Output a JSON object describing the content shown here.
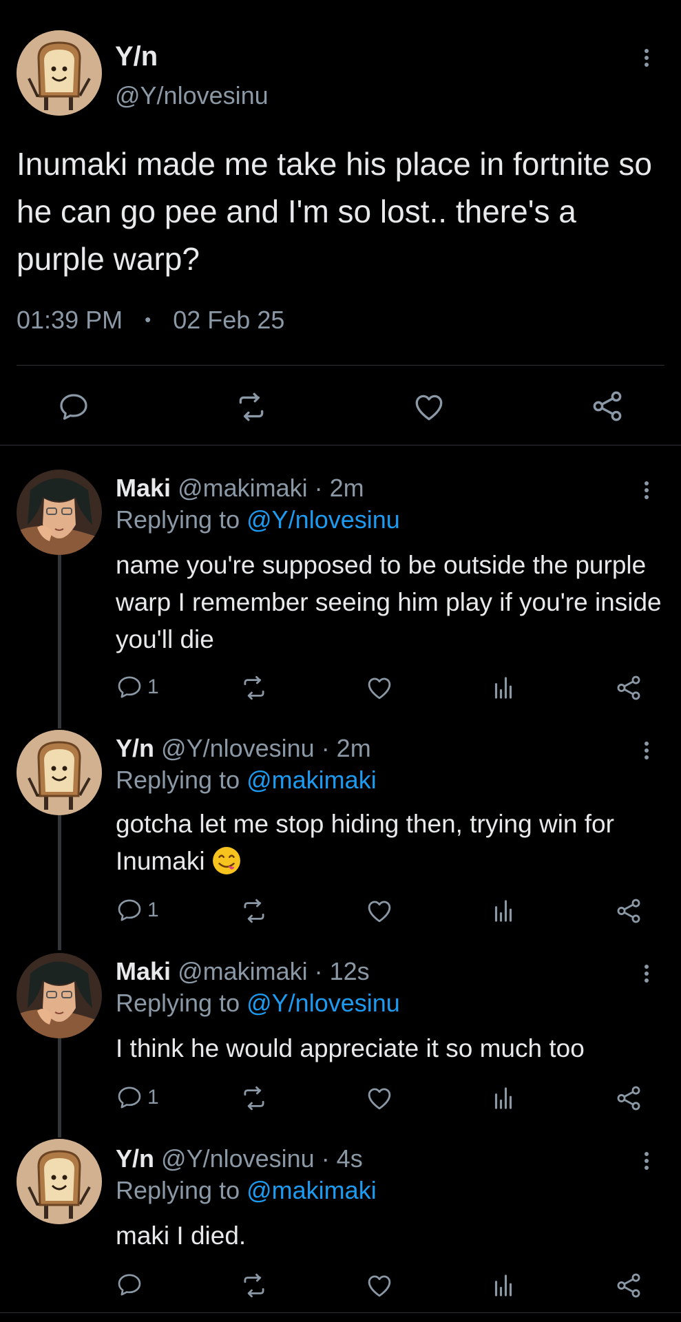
{
  "main_tweet": {
    "display_name": "Y/n",
    "handle": "@Y/nlovesinu",
    "text": "Inumaki made me take his place in fortnite so he can go pee and I'm so lost.. there's a purple warp?",
    "time": "01:39 PM",
    "dot": "•",
    "date": "02 Feb 25",
    "avatar": "bread-avatar-icon"
  },
  "replies": [
    {
      "display_name": "Maki",
      "handle_time": "@makimaki · 2m",
      "replying_to": "Replying to",
      "mention": "@Y/nlovesinu",
      "text": "name you're supposed to be outside the purple warp I remember seeing him play if you're inside you'll die",
      "reply_count": "1",
      "avatar": "anime-girl-avatar-icon"
    },
    {
      "display_name": "Y/n",
      "handle_time": "@Y/nlovesinu · 2m",
      "replying_to": "Replying to",
      "mention": "@makimaki",
      "text": "gotcha let me stop hiding then, trying win for Inumaki",
      "emoji": "face-savoring-food-emoji",
      "reply_count": "1",
      "avatar": "bread-avatar-icon"
    },
    {
      "display_name": "Maki",
      "handle_time": "@makimaki · 12s",
      "replying_to": "Replying to",
      "mention": "@Y/nlovesinu",
      "text": "I think he would appreciate it so much too",
      "reply_count": "1",
      "avatar": "anime-girl-avatar-icon"
    },
    {
      "display_name": "Y/n",
      "handle_time": "@Y/nlovesinu · 4s",
      "replying_to": "Replying to",
      "mention": "@makimaki",
      "text": "maki I died.",
      "reply_count": "",
      "avatar": "bread-avatar-icon"
    }
  ],
  "colors": {
    "background": "#000000",
    "text": "#e7e9ea",
    "secondary": "#8b98a5",
    "mention": "#1d9bf0",
    "divider": "#2f3336"
  }
}
